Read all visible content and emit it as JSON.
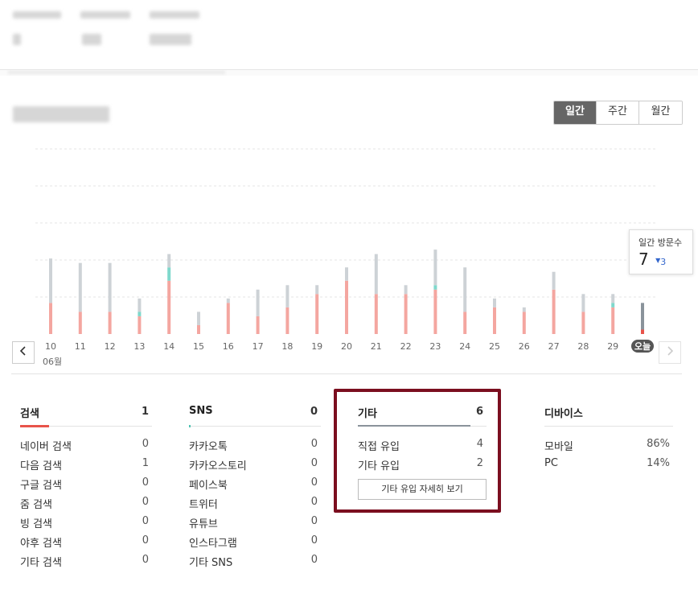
{
  "period_tabs": [
    "일간",
    "주간",
    "월간"
  ],
  "active_period": "일간",
  "nav": {
    "prev_icon": "chevron-left-icon",
    "next_icon": "chevron-right-icon"
  },
  "chart_data": {
    "type": "bar",
    "stacked": true,
    "title": "",
    "month_label": "06월",
    "categories": [
      "10",
      "11",
      "12",
      "13",
      "14",
      "15",
      "16",
      "17",
      "18",
      "19",
      "20",
      "21",
      "22",
      "23",
      "24",
      "25",
      "26",
      "27",
      "28",
      "29",
      "오늘"
    ],
    "series": [
      {
        "values": [
          7,
          5,
          5,
          4,
          12,
          2,
          7,
          4,
          6,
          9,
          12,
          9,
          9,
          10,
          5,
          6,
          5,
          10,
          5,
          6,
          1
        ],
        "color": "#f4a6a0"
      },
      {
        "values": [
          0,
          0,
          0,
          1,
          3,
          0,
          0,
          0,
          0,
          0,
          0,
          0,
          0,
          1,
          0,
          0,
          0,
          0,
          0,
          1,
          0
        ],
        "color": "#7fd8cc"
      },
      {
        "values": [
          10,
          11,
          11,
          3,
          3,
          3,
          1,
          6,
          5,
          2,
          3,
          9,
          2,
          8,
          10,
          2,
          1,
          4,
          4,
          2,
          6
        ],
        "color": "#cdd2d6"
      }
    ],
    "today_label": "오늘",
    "gridlines": 5,
    "ylim": [
      0,
      25
    ]
  },
  "tooltip": {
    "label": "일간 방문수",
    "value": "7",
    "delta_icon": "triangle-down-icon",
    "delta": "3"
  },
  "panels": {
    "search": {
      "title": "검색",
      "count": "1",
      "accent": "#e8534a",
      "rows": [
        {
          "label": "네이버 검색",
          "value": "0"
        },
        {
          "label": "다음 검색",
          "value": "1"
        },
        {
          "label": "구글 검색",
          "value": "0"
        },
        {
          "label": "줌 검색",
          "value": "0"
        },
        {
          "label": "빙 검색",
          "value": "0"
        },
        {
          "label": "야후 검색",
          "value": "0"
        },
        {
          "label": "기타 검색",
          "value": "0"
        }
      ]
    },
    "sns": {
      "title": "SNS",
      "count": "0",
      "accent": "#4fc3b3",
      "rows": [
        {
          "label": "카카오톡",
          "value": "0"
        },
        {
          "label": "카카오스토리",
          "value": "0"
        },
        {
          "label": "페이스북",
          "value": "0"
        },
        {
          "label": "트위터",
          "value": "0"
        },
        {
          "label": "유튜브",
          "value": "0"
        },
        {
          "label": "인스타그램",
          "value": "0"
        },
        {
          "label": "기타 SNS",
          "value": "0"
        }
      ]
    },
    "other": {
      "title": "기타",
      "count": "6",
      "accent": "#8a939b",
      "rows": [
        {
          "label": "직접 유입",
          "value": "4"
        },
        {
          "label": "기타 유입",
          "value": "2"
        }
      ],
      "button": "기타 유입 자세히 보기"
    },
    "device": {
      "title": "디바이스",
      "rows": [
        {
          "label": "모바일",
          "value": "86%"
        },
        {
          "label": "PC",
          "value": "14%"
        }
      ]
    }
  }
}
